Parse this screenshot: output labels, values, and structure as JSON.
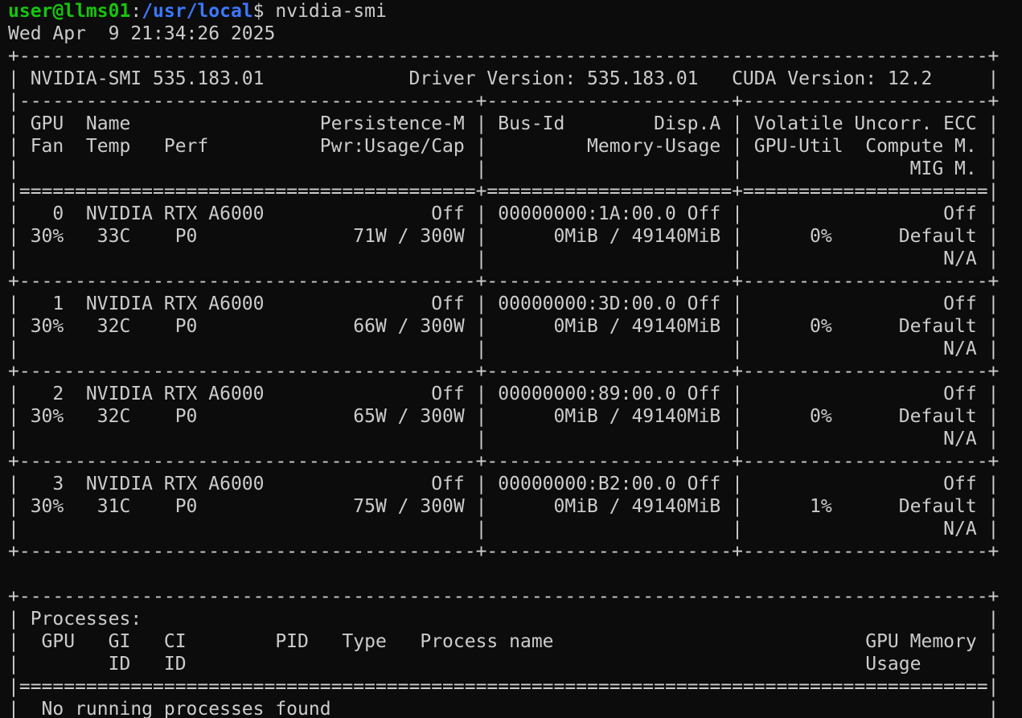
{
  "theme": {
    "background": "#0c0c0c",
    "foreground": "#cccccc",
    "user_color": "#16c60c",
    "path_color": "#3b78ff"
  },
  "prompt": {
    "user_host": "user@llms01",
    "separator": ":",
    "path": "/usr/local",
    "symbol": "$ ",
    "command": "nvidia-smi"
  },
  "output": [
    "Wed Apr  9 21:34:26 2025",
    "+---------------------------------------------------------------------------------------+",
    "| NVIDIA-SMI 535.183.01             Driver Version: 535.183.01   CUDA Version: 12.2     |",
    "|-----------------------------------------+----------------------+----------------------+",
    "| GPU  Name                 Persistence-M | Bus-Id        Disp.A | Volatile Uncorr. ECC |",
    "| Fan  Temp   Perf          Pwr:Usage/Cap |         Memory-Usage | GPU-Util  Compute M. |",
    "|                                         |                      |               MIG M. |",
    "|=========================================+======================+======================|",
    "|   0  NVIDIA RTX A6000               Off | 00000000:1A:00.0 Off |                  Off |",
    "| 30%   33C    P0              71W / 300W |      0MiB / 49140MiB |      0%      Default |",
    "|                                         |                      |                  N/A |",
    "+-----------------------------------------+----------------------+----------------------+",
    "|   1  NVIDIA RTX A6000               Off | 00000000:3D:00.0 Off |                  Off |",
    "| 30%   32C    P0              66W / 300W |      0MiB / 49140MiB |      0%      Default |",
    "|                                         |                      |                  N/A |",
    "+-----------------------------------------+----------------------+----------------------+",
    "|   2  NVIDIA RTX A6000               Off | 00000000:89:00.0 Off |                  Off |",
    "| 30%   32C    P0              65W / 300W |      0MiB / 49140MiB |      0%      Default |",
    "|                                         |                      |                  N/A |",
    "+-----------------------------------------+----------------------+----------------------+",
    "|   3  NVIDIA RTX A6000               Off | 00000000:B2:00.0 Off |                  Off |",
    "| 30%   31C    P0              75W / 300W |      0MiB / 49140MiB |      1%      Default |",
    "|                                         |                      |                  N/A |",
    "+-----------------------------------------+----------------------+----------------------+",
    "",
    "+---------------------------------------------------------------------------------------+",
    "| Processes:                                                                            |",
    "|  GPU   GI   CI        PID   Type   Process name                            GPU Memory |",
    "|        ID   ID                                                             Usage      |",
    "|=======================================================================================|",
    "|  No running processes found                                                           |"
  ]
}
